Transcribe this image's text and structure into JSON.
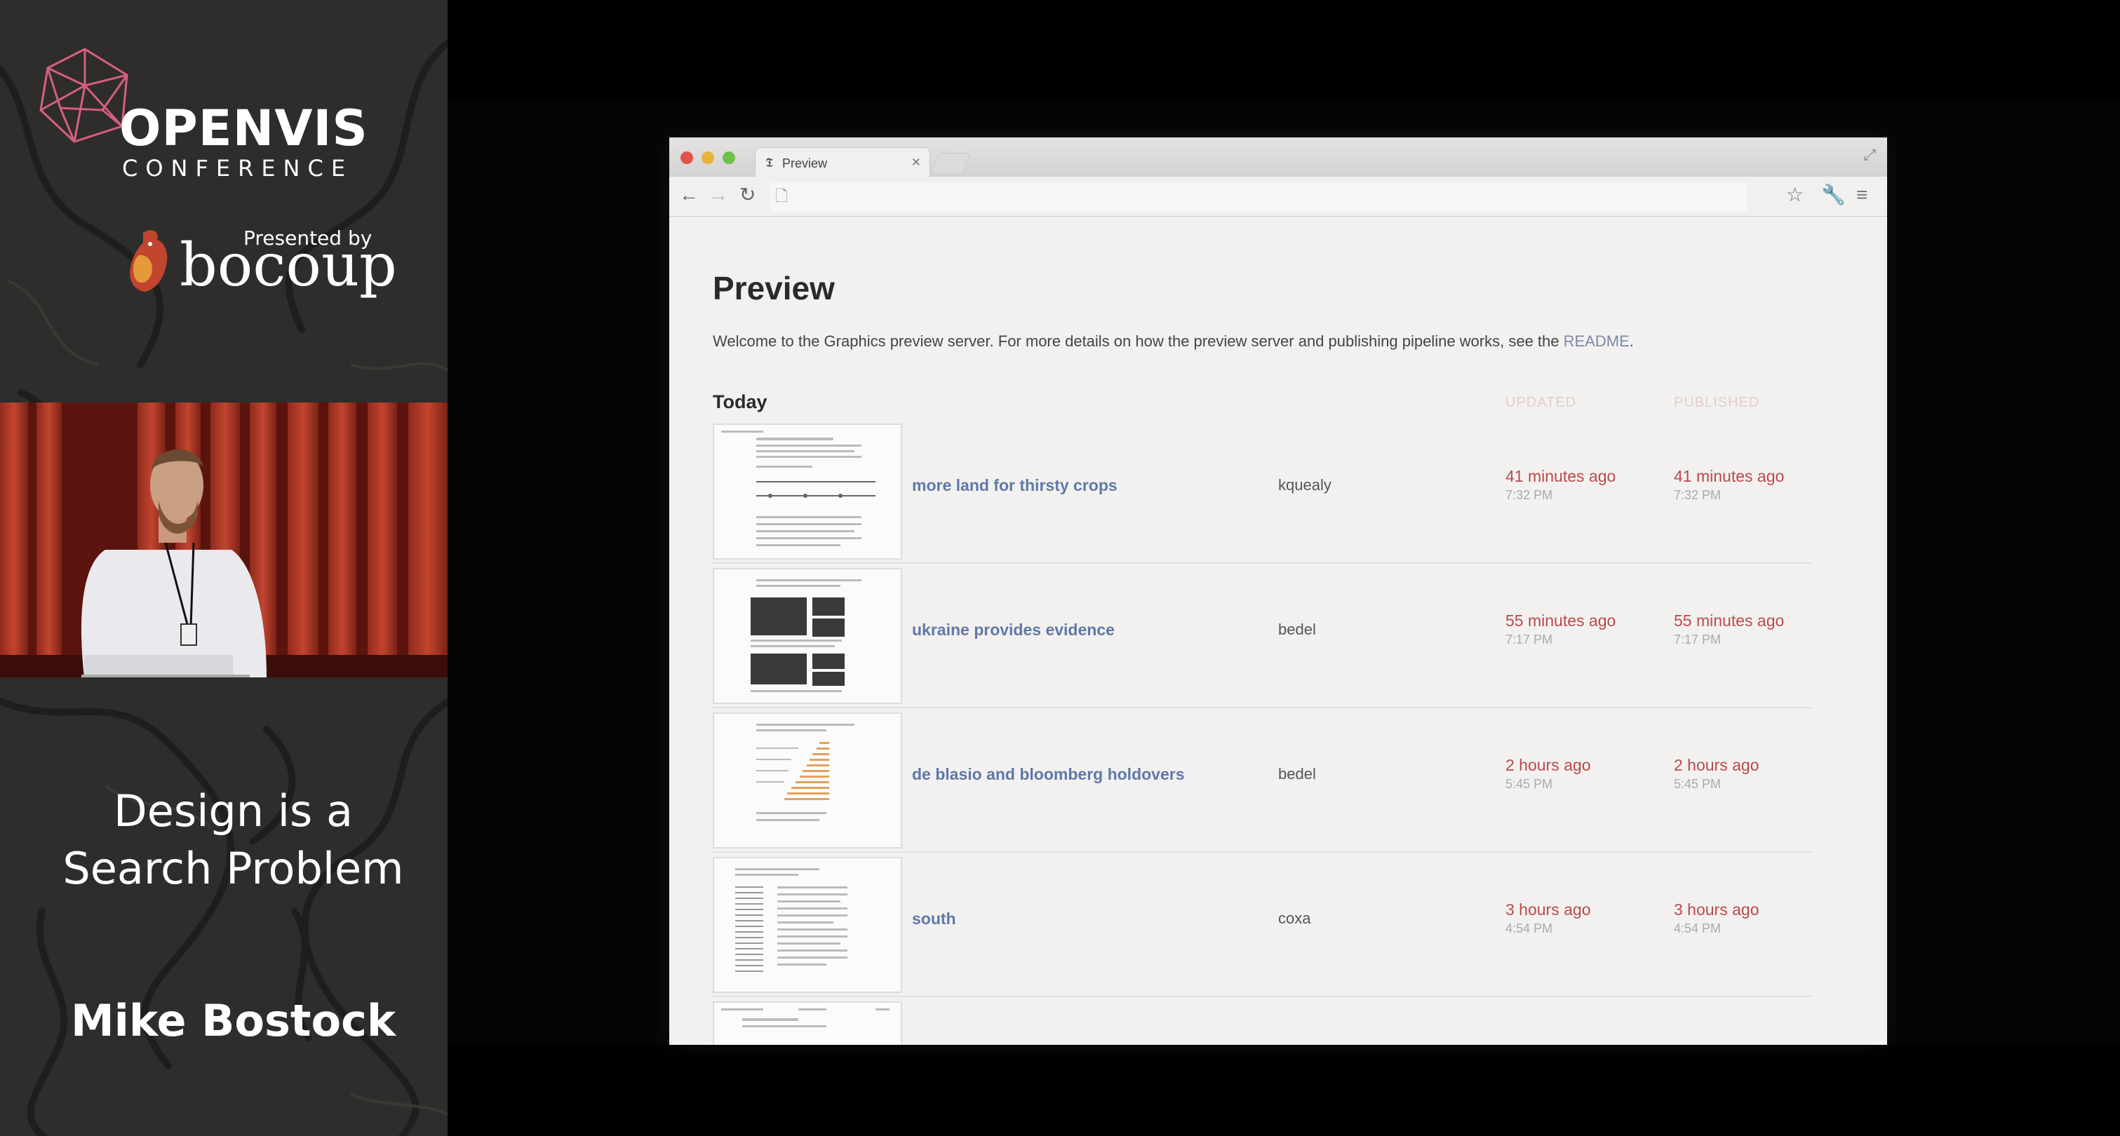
{
  "conference": {
    "name": "OPENVIS",
    "subtitle": "CONFERENCE",
    "presented_by": "Presented by",
    "sponsor": "bocoup"
  },
  "talk": {
    "title_line1": "Design is a",
    "title_line2": "Search Problem",
    "speaker": "Mike Bostock"
  },
  "browser": {
    "tab_label": "Preview",
    "icons": [
      "back-icon",
      "forward-icon",
      "reload-icon",
      "page-icon",
      "star-icon",
      "wrench-icon",
      "menu-icon",
      "fullscreen-icon",
      "close-icon"
    ]
  },
  "page": {
    "title": "Preview",
    "intro_text": "Welcome to the Graphics preview server. For more details on how the preview server and publishing pipeline works, see the ",
    "intro_link": "README",
    "intro_end": ".",
    "section": "Today",
    "col_updated": "UPDATED",
    "col_published": "PUBLISHED",
    "rows": [
      {
        "title": "more land for thirsty crops",
        "author": "kquealy",
        "updated_rel": "41 minutes ago",
        "updated_abs": "7:32 PM",
        "published_rel": "41 minutes ago",
        "published_abs": "7:32 PM"
      },
      {
        "title": "ukraine provides evidence",
        "author": "bedel",
        "updated_rel": "55 minutes ago",
        "updated_abs": "7:17 PM",
        "published_rel": "55 minutes ago",
        "published_abs": "7:17 PM"
      },
      {
        "title": "de blasio and bloomberg holdovers",
        "author": "bedel",
        "updated_rel": "2 hours ago",
        "updated_abs": "5:45 PM",
        "published_rel": "2 hours ago",
        "published_abs": "5:45 PM"
      },
      {
        "title": "south",
        "author": "coxa",
        "updated_rel": "3 hours ago",
        "updated_abs": "4:54 PM",
        "published_rel": "3 hours ago",
        "published_abs": "4:54 PM"
      }
    ]
  },
  "colors": {
    "link": "#5f79a8",
    "time": "#b94a4a",
    "brand_pink": "#d65f7d"
  }
}
